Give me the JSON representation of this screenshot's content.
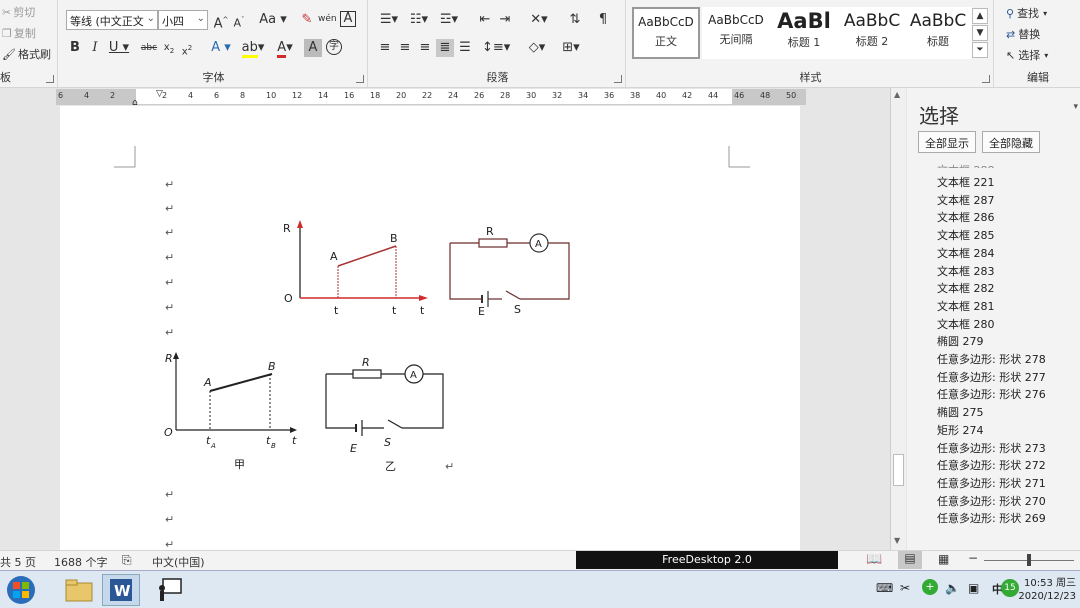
{
  "ribbon": {
    "clipboard": {
      "cut": "剪切",
      "copy": "复制",
      "format_painter": "格式刷",
      "label": "板"
    },
    "font": {
      "font_name": "等线 (中文正文",
      "font_size": "小四",
      "label": "字体"
    },
    "paragraph": {
      "label": "段落"
    },
    "styles": {
      "label": "样式",
      "items": [
        {
          "sample": "AaBbCcD",
          "name": "正文"
        },
        {
          "sample": "AaBbCcD",
          "name": "无间隔"
        },
        {
          "sample": "AaBl",
          "name": "标题 1"
        },
        {
          "sample": "AaBbC",
          "name": "标题 2"
        },
        {
          "sample": "AaBbC",
          "name": "标题"
        }
      ]
    },
    "editing": {
      "find": "查找",
      "replace": "替换",
      "select": "选择",
      "label": "编辑"
    }
  },
  "ruler": {
    "ticks": [
      "6",
      "4",
      "2",
      "",
      "2",
      "4",
      "6",
      "8",
      "10",
      "12",
      "14",
      "16",
      "18",
      "20",
      "22",
      "24",
      "26",
      "28",
      "30",
      "32",
      "34",
      "36",
      "38",
      "40",
      "42",
      "44",
      "46",
      "48",
      "50"
    ]
  },
  "document": {
    "figure_top": {
      "graph": {
        "y_label": "R",
        "origin": "O",
        "a_label": "A",
        "b_label": "B",
        "t1_label": "t",
        "t2_label": "t",
        "t_label": "t"
      },
      "circuit": {
        "r_label": "R",
        "meter": "A",
        "e_label": "E",
        "s_label": "S"
      }
    },
    "figure_bottom": {
      "graph": {
        "y_label": "R",
        "origin": "O",
        "a_label": "A",
        "b_label": "B",
        "ta_label": "t",
        "ta_sub": "A",
        "tb_label": "t",
        "tb_sub": "B",
        "t_label": "t"
      },
      "circuit": {
        "r_label": "R",
        "meter": "A",
        "e_label": "E",
        "s_label": "S"
      },
      "caption_left": "甲",
      "caption_right": "乙"
    },
    "para_mark": "↵"
  },
  "selection_pane": {
    "title": "选择",
    "show_all": "全部显示",
    "hide_all": "全部隐藏",
    "items": [
      "文本框 221",
      "文本框 287",
      "文本框 286",
      "文本框 285",
      "文本框 284",
      "文本框 283",
      "文本框 282",
      "文本框 281",
      "文本框 280",
      "椭圆 279",
      "任意多边形: 形状 278",
      "任意多边形: 形状 277",
      "任意多边形: 形状 276",
      "椭圆 275",
      "矩形 274",
      "任意多边形: 形状 273",
      "任意多边形: 形状 272",
      "任意多边形: 形状 271",
      "任意多边形: 形状 270",
      "任意多边形: 形状 269"
    ]
  },
  "status": {
    "pages": "共 5 页",
    "words": "1688 个字",
    "language": "中文(中国)",
    "overlay": "FreeDesktop 2.0"
  },
  "taskbar": {
    "time": "10:53",
    "weekday": "周三",
    "date": "2020/12/23",
    "badge": "15"
  },
  "colors": {
    "accent_red": "#d12b2b",
    "word_blue": "#2b5797"
  }
}
